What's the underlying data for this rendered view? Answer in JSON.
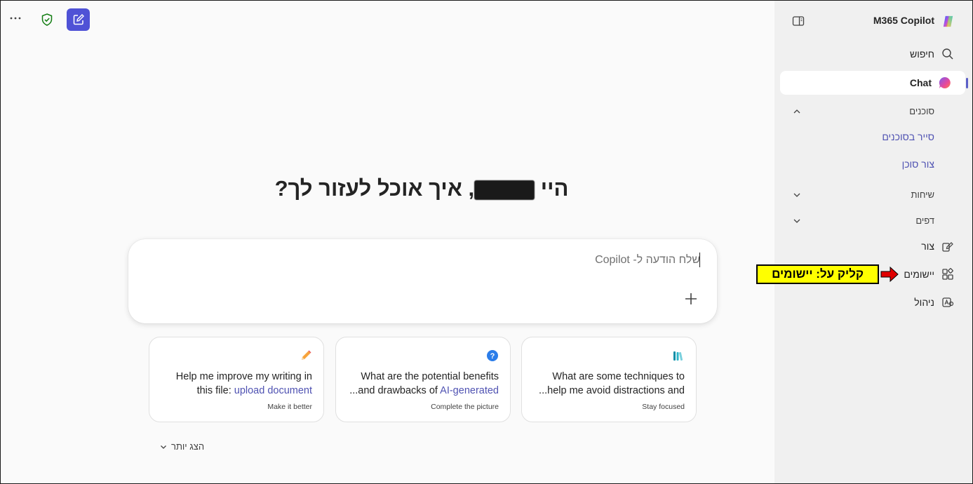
{
  "app": {
    "title": "M365 Copilot"
  },
  "sidebar": {
    "search_label": "חיפוש",
    "chat_label": "Chat",
    "agents_section": "סוכנים",
    "browse_agents": "סייר בסוכנים",
    "create_agent": "צור סוכן",
    "conversations_section": "שיחות",
    "pages_section": "דפים",
    "create_label": "צור",
    "apps_label": "יישומים",
    "admin_label": "ניהול"
  },
  "annotation": {
    "text": "קליק על: יישומים",
    "color": "#ffff00",
    "arrow_color": "#e00000"
  },
  "main": {
    "greeting_before": "היי ",
    "greeting_after": ", איך אוכל לעזור לך?",
    "composer_placeholder": "שלח הודעה ל- Copilot",
    "show_more": "הצג יותר"
  },
  "cards": [
    {
      "icon": "books-icon",
      "line1": "What are some techniques to",
      "line2": "...help me avoid distractions and",
      "subtitle": "Stay focused"
    },
    {
      "icon": "question-icon",
      "line1": "What are the potential benefits",
      "line2_prefix": "...and drawbacks of ",
      "line2_highlight": "AI-generated",
      "subtitle": "Complete the picture"
    },
    {
      "icon": "pencil-icon",
      "line1": "Help me improve my writing in",
      "line2_prefix": "this file: ",
      "line2_highlight": "upload document",
      "subtitle": "Make it better"
    }
  ],
  "colors": {
    "accent": "#4f52d6",
    "link": "#4f52b2",
    "sidebar_bg": "#f0f0f0"
  }
}
